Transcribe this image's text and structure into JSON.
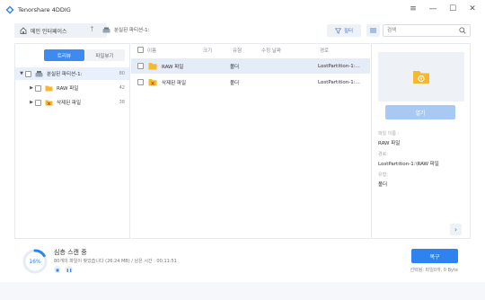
{
  "app": {
    "title": "Tenorshare 4DDIG",
    "controls": [
      "≡",
      "—",
      "☐",
      "✕"
    ]
  },
  "toolbar": {
    "home_label": "메인 인터페이스",
    "breadcrumb": "분실된 파티션-1:",
    "filter_label": "필터",
    "search_placeholder": "검색"
  },
  "left": {
    "tabs": [
      "트리뷰",
      "파일뷰기"
    ],
    "tree": [
      {
        "label": "분실된 파티션-1:",
        "count": "80",
        "caret": "▼"
      },
      {
        "label": "RAW 파일",
        "count": "42",
        "caret": "▶"
      },
      {
        "label": "삭제된 파일",
        "count": "38",
        "caret": "▶"
      }
    ]
  },
  "table": {
    "headers": {
      "name": "이름",
      "size": "크기",
      "type": "유형",
      "modified": "수정 날짜",
      "path": "경로"
    },
    "rows": [
      {
        "name": "RAW 파일",
        "type": "폴더",
        "path": "LostPartition-1:..."
      },
      {
        "name": "삭제된 파일",
        "type": "폴더",
        "path": "LostPartition-1:..."
      }
    ]
  },
  "details": {
    "open_label": "열기",
    "name_key": "파일 이름 :",
    "name_value": "RAW 파일",
    "path_key": "경로:",
    "path_value": "LostPartition-1:\\RAW 파일",
    "type_key": "유형:",
    "type_value": "폴더"
  },
  "scan": {
    "percent": "16%",
    "progress_value": 0.16,
    "title": "심층 스캔 중",
    "detail": "80개의 파일이 찾았습니다 (26.24 MB) / 남은 시간 : 00:11:51",
    "recover_label": "복구",
    "selection_info": "선택됨: 파일0개, 0 Byte"
  },
  "colors": {
    "accent": "#2f83ee",
    "folder": "#f5b82e"
  }
}
